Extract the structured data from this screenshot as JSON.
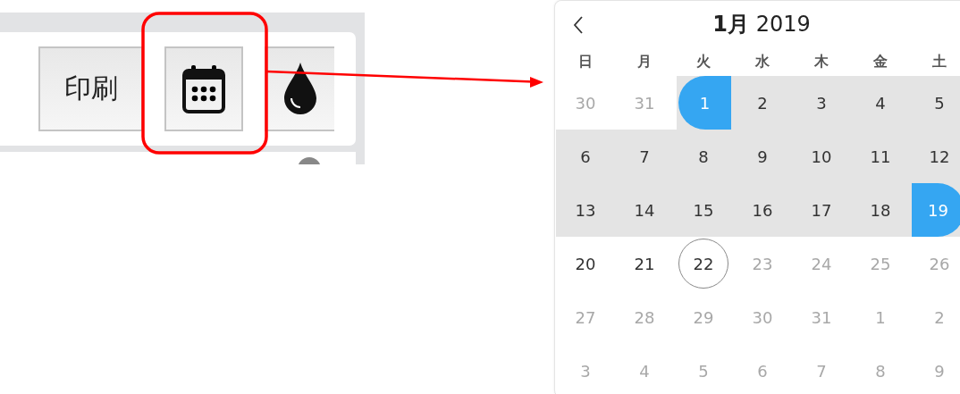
{
  "toolbar": {
    "buttons": [
      {
        "kind": "text",
        "label": "印刷",
        "highlighted": false
      },
      {
        "kind": "calendar",
        "highlighted": true
      },
      {
        "kind": "drop",
        "highlighted": false
      }
    ]
  },
  "calendar": {
    "month": "1月",
    "year": "2019",
    "weekdays": [
      "日",
      "月",
      "火",
      "水",
      "木",
      "金",
      "土"
    ],
    "weeks": [
      [
        {
          "label": "30",
          "muted": true,
          "in_range": false,
          "selected": false,
          "today": false
        },
        {
          "label": "31",
          "muted": true,
          "in_range": false,
          "selected": false,
          "today": false
        },
        {
          "label": "1",
          "muted": false,
          "in_range": true,
          "selected": true,
          "today": false
        },
        {
          "label": "2",
          "muted": false,
          "in_range": true,
          "selected": false,
          "today": false
        },
        {
          "label": "3",
          "muted": false,
          "in_range": true,
          "selected": false,
          "today": false
        },
        {
          "label": "4",
          "muted": false,
          "in_range": true,
          "selected": false,
          "today": false
        },
        {
          "label": "5",
          "muted": false,
          "in_range": true,
          "selected": false,
          "today": false
        }
      ],
      [
        {
          "label": "6",
          "muted": false,
          "in_range": true,
          "selected": false,
          "today": false
        },
        {
          "label": "7",
          "muted": false,
          "in_range": true,
          "selected": false,
          "today": false
        },
        {
          "label": "8",
          "muted": false,
          "in_range": true,
          "selected": false,
          "today": false
        },
        {
          "label": "9",
          "muted": false,
          "in_range": true,
          "selected": false,
          "today": false
        },
        {
          "label": "10",
          "muted": false,
          "in_range": true,
          "selected": false,
          "today": false
        },
        {
          "label": "11",
          "muted": false,
          "in_range": true,
          "selected": false,
          "today": false
        },
        {
          "label": "12",
          "muted": false,
          "in_range": true,
          "selected": false,
          "today": false
        }
      ],
      [
        {
          "label": "13",
          "muted": false,
          "in_range": true,
          "selected": false,
          "today": false
        },
        {
          "label": "14",
          "muted": false,
          "in_range": true,
          "selected": false,
          "today": false
        },
        {
          "label": "15",
          "muted": false,
          "in_range": true,
          "selected": false,
          "today": false
        },
        {
          "label": "16",
          "muted": false,
          "in_range": true,
          "selected": false,
          "today": false
        },
        {
          "label": "17",
          "muted": false,
          "in_range": true,
          "selected": false,
          "today": false
        },
        {
          "label": "18",
          "muted": false,
          "in_range": true,
          "selected": false,
          "today": false
        },
        {
          "label": "19",
          "muted": false,
          "in_range": true,
          "selected": true,
          "today": false
        }
      ],
      [
        {
          "label": "20",
          "muted": false,
          "in_range": false,
          "selected": false,
          "today": false
        },
        {
          "label": "21",
          "muted": false,
          "in_range": false,
          "selected": false,
          "today": false
        },
        {
          "label": "22",
          "muted": false,
          "in_range": false,
          "selected": false,
          "today": true
        },
        {
          "label": "23",
          "muted": true,
          "in_range": false,
          "selected": false,
          "today": false
        },
        {
          "label": "24",
          "muted": true,
          "in_range": false,
          "selected": false,
          "today": false
        },
        {
          "label": "25",
          "muted": true,
          "in_range": false,
          "selected": false,
          "today": false
        },
        {
          "label": "26",
          "muted": true,
          "in_range": false,
          "selected": false,
          "today": false
        }
      ],
      [
        {
          "label": "27",
          "muted": true,
          "in_range": false,
          "selected": false,
          "today": false
        },
        {
          "label": "28",
          "muted": true,
          "in_range": false,
          "selected": false,
          "today": false
        },
        {
          "label": "29",
          "muted": true,
          "in_range": false,
          "selected": false,
          "today": false
        },
        {
          "label": "30",
          "muted": true,
          "in_range": false,
          "selected": false,
          "today": false
        },
        {
          "label": "31",
          "muted": true,
          "in_range": false,
          "selected": false,
          "today": false
        },
        {
          "label": "1",
          "muted": true,
          "in_range": false,
          "selected": false,
          "today": false
        },
        {
          "label": "2",
          "muted": true,
          "in_range": false,
          "selected": false,
          "today": false
        }
      ],
      [
        {
          "label": "3",
          "muted": true,
          "in_range": false,
          "selected": false,
          "today": false
        },
        {
          "label": "4",
          "muted": true,
          "in_range": false,
          "selected": false,
          "today": false
        },
        {
          "label": "5",
          "muted": true,
          "in_range": false,
          "selected": false,
          "today": false
        },
        {
          "label": "6",
          "muted": true,
          "in_range": false,
          "selected": false,
          "today": false
        },
        {
          "label": "7",
          "muted": true,
          "in_range": false,
          "selected": false,
          "today": false
        },
        {
          "label": "8",
          "muted": true,
          "in_range": false,
          "selected": false,
          "today": false
        },
        {
          "label": "9",
          "muted": true,
          "in_range": false,
          "selected": false,
          "today": false
        }
      ]
    ]
  }
}
